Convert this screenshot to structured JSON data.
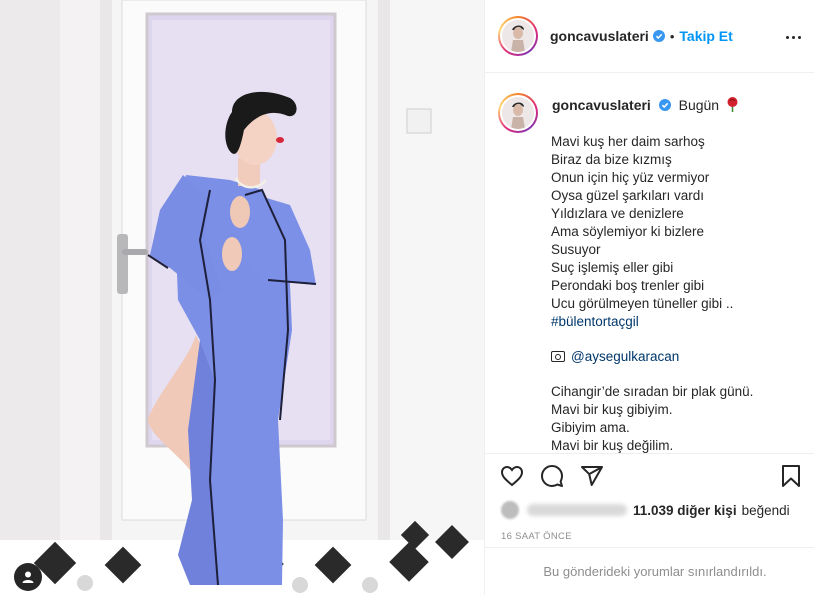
{
  "post": {
    "username": "goncavuslateri",
    "follow_label": "Takip Et",
    "separator": "•",
    "caption_title": "Bugün",
    "caption_lines": [
      "Mavi kuş her daim sarhoş",
      "Biraz da bize kızmış",
      "Onun için hiç yüz vermiyor",
      "Oysa güzel şarkıları vardı",
      "Yıldızlara ve denizlere",
      "Ama söylemiyor ki bizlere",
      "Susuyor",
      "Suç işlemiş eller gibi",
      "Perondaki boş trenler gibi",
      "Ucu görülmeyen tüneller gibi .."
    ],
    "hashtag": "#bülentortaçgil",
    "photo_credit": "@aysegulkaracan",
    "caption_lines_2": [
      "Cihangir’de sıradan bir plak günü.",
      "Mavi bir kuş gibiyim.",
      "Gibiyim ama.",
      "Mavi bir kuş değilim."
    ],
    "likes_count": "11.039 diğer kişi",
    "likes_suffix": "beğendi",
    "timestamp": "16 SAAT ÖNCE",
    "comments_restricted": "Bu gönderideki yorumlar sınırlandırıldı."
  },
  "colors": {
    "accent": "#0095f6",
    "hashtag": "#00376b",
    "muted": "#8e8e8e",
    "text": "#262626",
    "robe": "#7b8fe6"
  },
  "icons": [
    "heart-icon",
    "comment-icon",
    "share-icon",
    "bookmark-icon",
    "more-options-icon",
    "verified-icon",
    "rose-icon",
    "camera-icon",
    "user-tag-icon"
  ]
}
